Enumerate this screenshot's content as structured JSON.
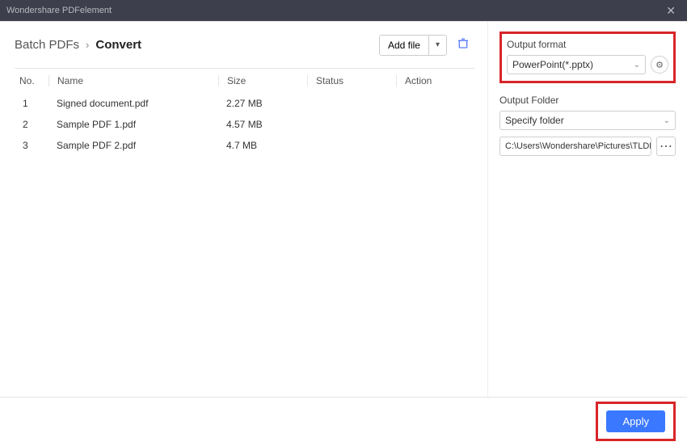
{
  "app_title": "Wondershare PDFelement",
  "breadcrumb": {
    "parent": "Batch PDFs",
    "current": "Convert"
  },
  "toolbar": {
    "add_file": "Add file"
  },
  "table": {
    "headers": {
      "no": "No.",
      "name": "Name",
      "size": "Size",
      "status": "Status",
      "action": "Action"
    },
    "rows": [
      {
        "no": "1",
        "name": "Signed document.pdf",
        "size": "2.27 MB"
      },
      {
        "no": "2",
        "name": "Sample PDF 1.pdf",
        "size": "4.57 MB"
      },
      {
        "no": "3",
        "name": "Sample PDF 2.pdf",
        "size": "4.7 MB"
      }
    ]
  },
  "right": {
    "output_format_label": "Output format",
    "output_format_value": "PowerPoint(*.pptx)",
    "output_folder_label": "Output Folder",
    "output_folder_select": "Specify folder",
    "output_folder_path": "C:\\Users\\Wondershare\\Pictures\\TLDR T"
  },
  "footer": {
    "apply": "Apply"
  }
}
